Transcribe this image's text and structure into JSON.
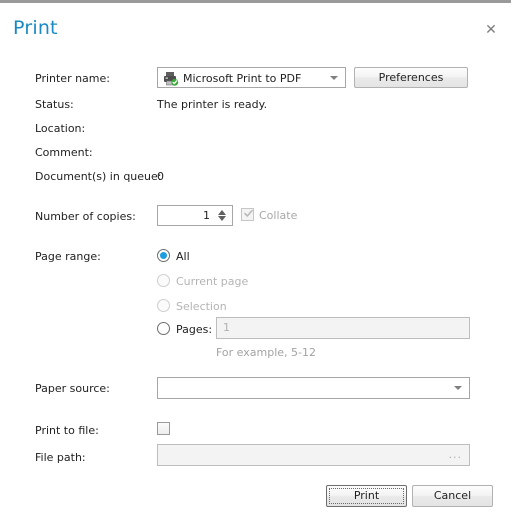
{
  "dialog": {
    "title": "Print",
    "close_icon": "close-icon"
  },
  "printer": {
    "name_label": "Printer name:",
    "selected": "Microsoft Print to PDF",
    "icon": "printer-ready-icon",
    "preferences_label": "Preferences",
    "status_label": "Status:",
    "status_value": "The printer is ready.",
    "location_label": "Location:",
    "location_value": "",
    "comment_label": "Comment:",
    "comment_value": "",
    "queue_label": "Document(s) in queue:",
    "queue_value": "0"
  },
  "copies": {
    "label": "Number of copies:",
    "value": "1",
    "collate_label": "Collate",
    "collate_checked": true,
    "collate_enabled": false
  },
  "page_range": {
    "label": "Page range:",
    "options": [
      {
        "label": "All",
        "selected": true,
        "enabled": true
      },
      {
        "label": "Current page",
        "selected": false,
        "enabled": false
      },
      {
        "label": "Selection",
        "selected": false,
        "enabled": false
      },
      {
        "label": "Pages:",
        "selected": false,
        "enabled": true
      }
    ],
    "pages_value": "",
    "pages_placeholder": "1",
    "pages_hint": "For example, 5-12"
  },
  "paper_source": {
    "label": "Paper source:",
    "selected": ""
  },
  "print_to_file": {
    "label": "Print to file:",
    "checked": false
  },
  "file_path": {
    "label": "File path:",
    "value": "",
    "browse_label": "..."
  },
  "footer": {
    "print_label": "Print",
    "cancel_label": "Cancel"
  }
}
